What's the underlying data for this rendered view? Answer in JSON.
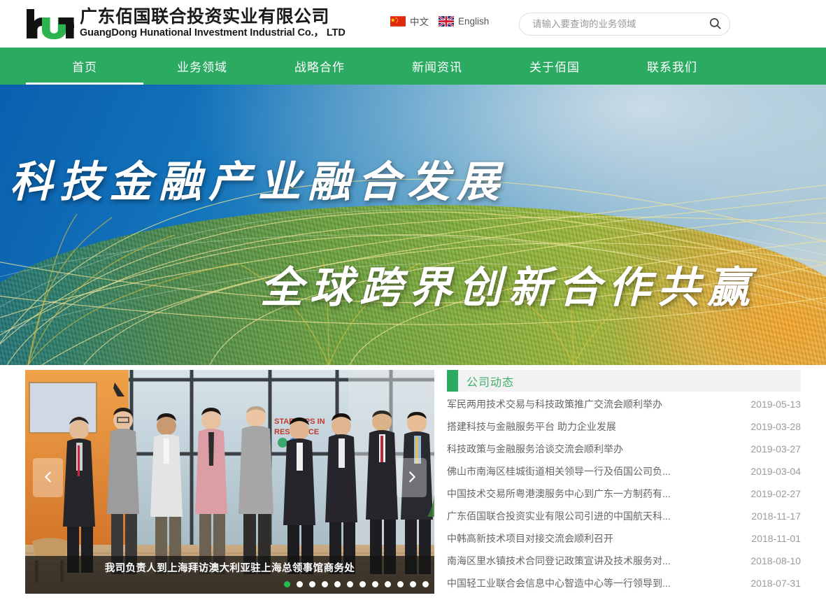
{
  "brand": {
    "logo_text": "hun",
    "name_cn": "广东佰国联合投资实业有限公司",
    "name_en": "GuangDong Hunational Investment Industrial Co.， LTD"
  },
  "languages": [
    {
      "label": "中文",
      "icon": "flag-china-icon"
    },
    {
      "label": "English",
      "icon": "flag-uk-icon"
    }
  ],
  "search": {
    "placeholder": "请输入要查询的业务领域",
    "value": "",
    "icon": "search-icon"
  },
  "nav": {
    "items": [
      {
        "label": "首页",
        "active": true
      },
      {
        "label": "业务领域",
        "active": false
      },
      {
        "label": "战略合作",
        "active": false
      },
      {
        "label": "新闻资讯",
        "active": false
      },
      {
        "label": "关于佰国",
        "active": false
      },
      {
        "label": "联系我们",
        "active": false
      }
    ]
  },
  "hero": {
    "line1": "科技金融产业融合发展",
    "line2": "全球跨界创新合作共赢"
  },
  "carousel": {
    "caption": "我司负责人到上海拜访澳大利亚驻上海总领事馆商务处",
    "prev_icon": "chevron-left-icon",
    "next_icon": "chevron-right-icon",
    "slide_count": 12,
    "active_index": 0,
    "poster_text": "STARTUPS IN RESIDENCE"
  },
  "news": {
    "title": "公司动态",
    "items": [
      {
        "title": "军民两用技术交易与科技政策推广交流会顺利举办",
        "date": "2019-05-13"
      },
      {
        "title": "搭建科技与金融服务平台 助力企业发展",
        "date": "2019-03-28"
      },
      {
        "title": "科技政策与金融服务洽谈交流会顺利举办",
        "date": "2019-03-27"
      },
      {
        "title": "佛山市南海区桂城街道相关领导一行及佰国公司负...",
        "date": "2019-03-04"
      },
      {
        "title": "中国技术交易所粤港澳服务中心到广东一方制药有...",
        "date": "2019-02-27"
      },
      {
        "title": "广东佰国联合投资实业有限公司引进的中国航天科...",
        "date": "2018-11-17"
      },
      {
        "title": "中韩高新技术项目对接交流会顺利召开",
        "date": "2018-11-01"
      },
      {
        "title": "南海区里水镇技术合同登记政策宣讲及技术服务对...",
        "date": "2018-08-10"
      },
      {
        "title": "中国轻工业联合会信息中心智造中心等一行领导到...",
        "date": "2018-07-31"
      }
    ]
  },
  "colors": {
    "brand_green": "#2bab62",
    "news_title_green": "#3fae6d",
    "active_dot_green": "#22bb4f",
    "text_dark": "#1a1a1a",
    "text_muted": "#666666"
  }
}
